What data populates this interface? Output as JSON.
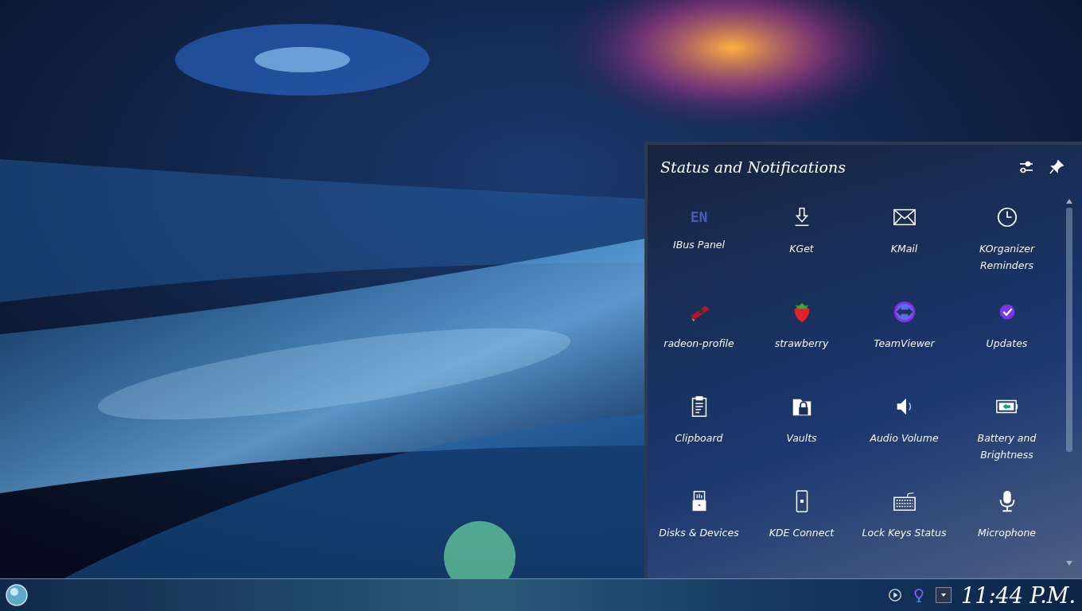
{
  "panel": {
    "title": "Status and Notifications"
  },
  "items": [
    {
      "label": "IBus Panel",
      "kind": "text",
      "icon_text": "EN"
    },
    {
      "label": "KGet",
      "kind": "download"
    },
    {
      "label": "KMail",
      "kind": "mail"
    },
    {
      "label": "KOrganizer Reminders",
      "kind": "clock"
    },
    {
      "label": "radeon-profile",
      "kind": "card"
    },
    {
      "label": "strawberry",
      "kind": "strawberry"
    },
    {
      "label": "TeamViewer",
      "kind": "teamviewer"
    },
    {
      "label": "Updates",
      "kind": "updates"
    },
    {
      "label": "Clipboard",
      "kind": "clipboard"
    },
    {
      "label": "Vaults",
      "kind": "vault"
    },
    {
      "label": "Audio Volume",
      "kind": "speaker"
    },
    {
      "label": "Battery and Brightness",
      "kind": "battery"
    },
    {
      "label": "Disks & Devices",
      "kind": "usb"
    },
    {
      "label": "KDE Connect",
      "kind": "phone"
    },
    {
      "label": "Lock Keys Status",
      "kind": "keyboard"
    },
    {
      "label": "Microphone",
      "kind": "microphone"
    }
  ],
  "taskbar": {
    "clock": "11:44 P.M."
  }
}
